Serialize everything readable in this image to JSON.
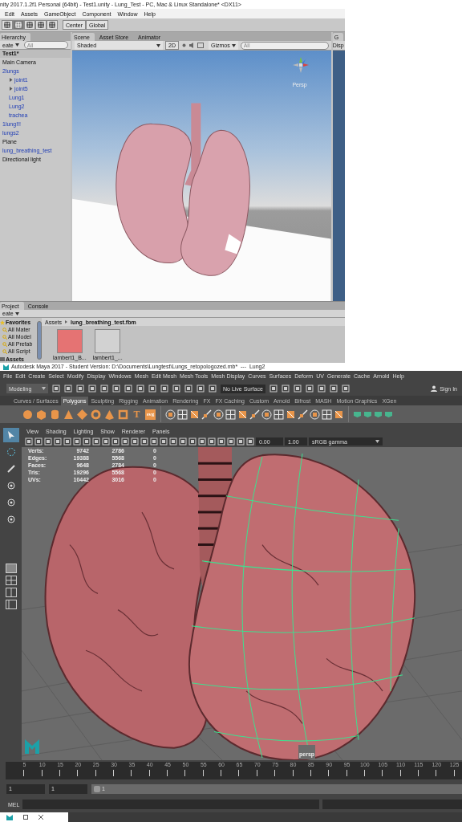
{
  "unity": {
    "title": "nity 2017.1.2f1 Personal (64bit) - Test1.unity - Lung_Test - PC, Mac & Linux Standalone* <DX11>",
    "menu": [
      "Edit",
      "Assets",
      "GameObject",
      "Component",
      "Window",
      "Help"
    ],
    "toolbar": {
      "pivot": "Center",
      "space": "Global"
    },
    "hierarchy": {
      "title": "Hierarchy",
      "create": "eate",
      "search": {
        "placeholder": "All"
      },
      "scene": "Test1*",
      "items": [
        {
          "name": "Main Camera",
          "kind": "object"
        },
        {
          "name": "2lungs",
          "kind": "prefab",
          "children": [
            {
              "name": "joint1",
              "kind": "prefab",
              "expanded": false
            },
            {
              "name": "joint5",
              "kind": "prefab",
              "expanded": false
            },
            {
              "name": "Lung1",
              "kind": "prefab"
            },
            {
              "name": "Lung2",
              "kind": "prefab"
            },
            {
              "name": "trachea",
              "kind": "prefab"
            }
          ]
        },
        {
          "name": "1lung!!!",
          "kind": "prefab"
        },
        {
          "name": "lungs2",
          "kind": "prefab"
        },
        {
          "name": "Plane",
          "kind": "object"
        },
        {
          "name": "lung_breathing_test",
          "kind": "prefab"
        },
        {
          "name": "Directional light",
          "kind": "object"
        }
      ]
    },
    "scene_tabs": [
      {
        "label": "Scene",
        "selected": true
      },
      {
        "label": "Asset Store",
        "selected": false
      },
      {
        "label": "Animator",
        "selected": false
      }
    ],
    "scene_toolbar": {
      "shading": "Shaded",
      "mode": "2D",
      "gizmos": "Gizmos",
      "search": {
        "placeholder": "All"
      }
    },
    "scene_view": {
      "camera": "Persp"
    },
    "inspector": {
      "tab": "G",
      "button": "Disp"
    },
    "project": {
      "tabs": [
        {
          "label": "Project",
          "selected": true
        },
        {
          "label": "Console",
          "selected": false
        }
      ],
      "create": "eate",
      "favorites": {
        "title": "Favorites",
        "items": [
          "All Mater",
          "All Model",
          "All Prefab",
          "All Script"
        ]
      },
      "assets": "Assets",
      "breadcrumb": [
        "Assets",
        "lung_breathing_test.fbm"
      ],
      "files": [
        {
          "name": "lambert1_B...",
          "color": "#e57373"
        },
        {
          "name": "lambert1_...",
          "color": "#d2d2d2"
        }
      ]
    }
  },
  "maya": {
    "title": "Autodesk Maya 2017 - Student Version: D:\\Documents\\Lungtest\\Lungs_retopologozed.mb*  ---  Lung2",
    "menu": [
      "File",
      "Edit",
      "Create",
      "Select",
      "Modify",
      "Display",
      "Windows",
      "Mesh",
      "Edit Mesh",
      "Mesh Tools",
      "Mesh Display",
      "Curves",
      "Surfaces",
      "Deform",
      "UV",
      "Generate",
      "Cache",
      "Arnold",
      "Help"
    ],
    "status": {
      "mode": "Modeling",
      "live_surface": "No Live Surface",
      "sign_in": "Sign In"
    },
    "shelf_tabs": [
      {
        "label": "Curves / Surfaces",
        "selected": false
      },
      {
        "label": "Polygons",
        "selected": true
      },
      {
        "label": "Sculpting",
        "selected": false
      },
      {
        "label": "Rigging",
        "selected": false
      },
      {
        "label": "Animation",
        "selected": false
      },
      {
        "label": "Rendering",
        "selected": false
      },
      {
        "label": "FX",
        "selected": false
      },
      {
        "label": "FX Caching",
        "selected": false
      },
      {
        "label": "Custom",
        "selected": false
      },
      {
        "label": "Arnold",
        "selected": false
      },
      {
        "label": "Bifrost",
        "selected": false
      },
      {
        "label": "MASH",
        "selected": false
      },
      {
        "label": "Motion Graphics",
        "selected": false
      },
      {
        "label": "XGen",
        "selected": false
      }
    ],
    "shelf_texts": [
      "T",
      "svg"
    ],
    "toolbox": [
      {
        "selected": true
      },
      {
        "selected": false
      },
      {
        "selected": false
      },
      {
        "selected": false
      },
      {
        "selected": false
      },
      {
        "selected": false
      }
    ],
    "panel_menu": [
      "View",
      "Shading",
      "Lighting",
      "Show",
      "Renderer",
      "Panels"
    ],
    "panel_fields": {
      "exposure": "0.00",
      "gamma": "1.00",
      "color_space": "sRGB gamma"
    },
    "hud": [
      {
        "label": "Verts:",
        "values": [
          "9742",
          "2786",
          "0"
        ]
      },
      {
        "label": "Edges:",
        "values": [
          "19388",
          "5568",
          "0"
        ]
      },
      {
        "label": "Faces:",
        "values": [
          "9648",
          "2784",
          "0"
        ]
      },
      {
        "label": "Tris:",
        "values": [
          "19296",
          "5568",
          "0"
        ]
      },
      {
        "label": "UVs:",
        "values": [
          "10442",
          "3016",
          "0"
        ]
      }
    ],
    "camera": "persp",
    "timeline": [
      "5",
      "10",
      "15",
      "20",
      "25",
      "30",
      "35",
      "40",
      "45",
      "50",
      "55",
      "60",
      "65",
      "70",
      "75",
      "80",
      "85",
      "90",
      "95",
      "100",
      "105",
      "110",
      "115",
      "120",
      "125"
    ],
    "range": {
      "start": "1",
      "end": "1",
      "current": "1"
    },
    "command": {
      "language": "MEL"
    }
  }
}
